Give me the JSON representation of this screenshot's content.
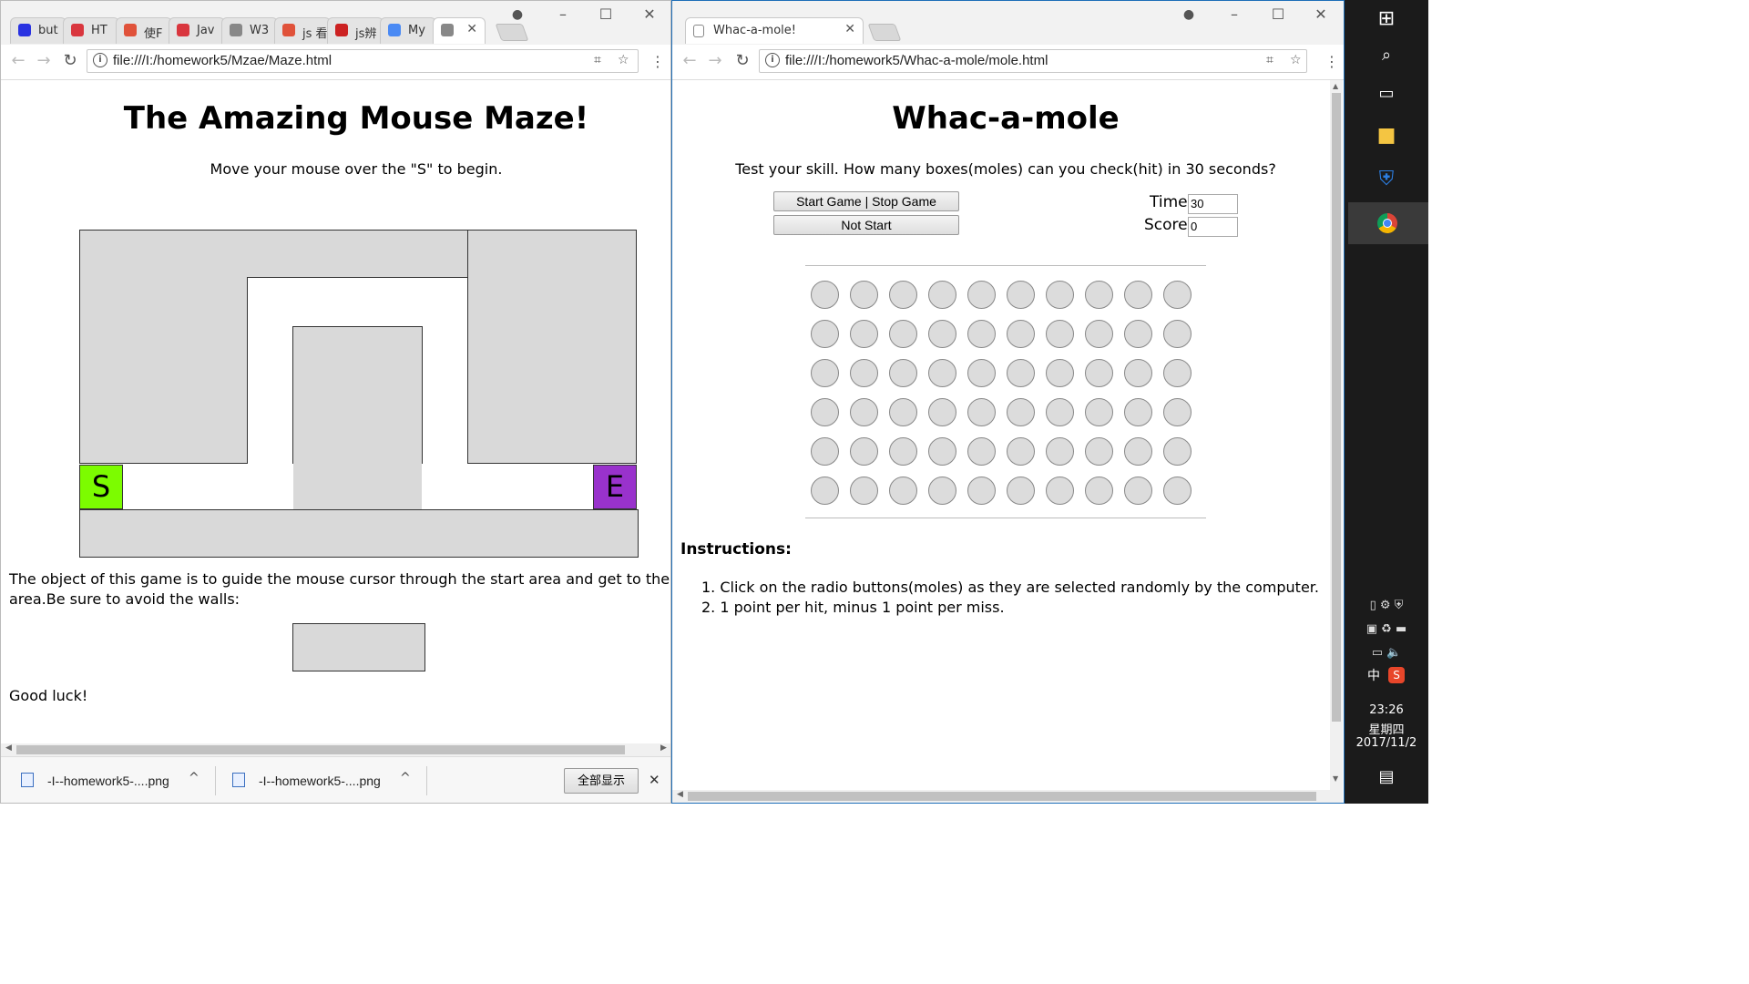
{
  "left_window": {
    "tabs": [
      {
        "label": "but",
        "icon": "baidu-paw-icon",
        "color": "#2932e1"
      },
      {
        "label": "HT",
        "icon": "html-shield-icon",
        "color": "#d9363e"
      },
      {
        "label": "使F",
        "icon": "runoob-logo-icon",
        "color": "#e0523a"
      },
      {
        "label": "Jav",
        "icon": "html-shield-icon",
        "color": "#d9363e"
      },
      {
        "label": "W3",
        "icon": "page-icon",
        "color": "#888888"
      },
      {
        "label": "js 看",
        "icon": "runoob-logo-icon",
        "color": "#e0523a"
      },
      {
        "label": "js辨",
        "icon": "csdn-c-icon",
        "color": "#cc2222"
      },
      {
        "label": "My",
        "icon": "drive-icon",
        "color": "#4a8af4"
      },
      {
        "label": "",
        "icon": "page-icon",
        "color": "#888888"
      }
    ],
    "close_tab_glyph": "✕",
    "url": "file:///I:/homework5/Mzae/Maze.html",
    "page": {
      "title": "The Amazing Mouse Maze!",
      "subtitle": "Move your mouse over the \"S\" to begin.",
      "start_label": "S",
      "end_label": "E",
      "start_color": "#7cfc00",
      "end_color": "#9932cc",
      "description": "The object of this game is to guide the mouse cursor through the start area and get to the en",
      "description_line2": "area.Be sure to avoid the walls:",
      "good_luck": "Good luck!"
    },
    "downloads": [
      {
        "name": "-I--homework5-....png",
        "icon": "image-file-icon"
      },
      {
        "name": "-I--homework5-....png",
        "icon": "image-file-icon"
      }
    ],
    "show_all": "全部显示",
    "download_close": "✕"
  },
  "right_window": {
    "tab_label": "Whac-a-mole!",
    "close_tab_glyph": "✕",
    "url": "file:///I:/homework5/Whac-a-mole/mole.html",
    "page": {
      "title": "Whac-a-mole",
      "subtitle": "Test your skill. How many boxes(moles) can you check(hit) in 30 seconds?",
      "start_stop_label": "Start Game | Stop Game",
      "status_label": "Not Start",
      "time_label": "Time:",
      "time_value": "30",
      "score_label": "Score:",
      "score_value": "0",
      "grid_rows": 6,
      "grid_cols": 10,
      "instructions_heading": "Instructions:",
      "instructions": [
        "Click on the radio buttons(moles) as they are selected randomly by the computer.",
        "1 point per hit, minus 1 point per miss."
      ]
    }
  },
  "taskbar": {
    "time": "23:26",
    "weekday": "星期四",
    "date": "2017/11/2",
    "ime": "中",
    "icons": [
      "windows-start-icon",
      "search-icon",
      "task-view-icon",
      "file-explorer-icon",
      "defender-shield-icon",
      "chrome-icon",
      "notification-icon"
    ]
  }
}
